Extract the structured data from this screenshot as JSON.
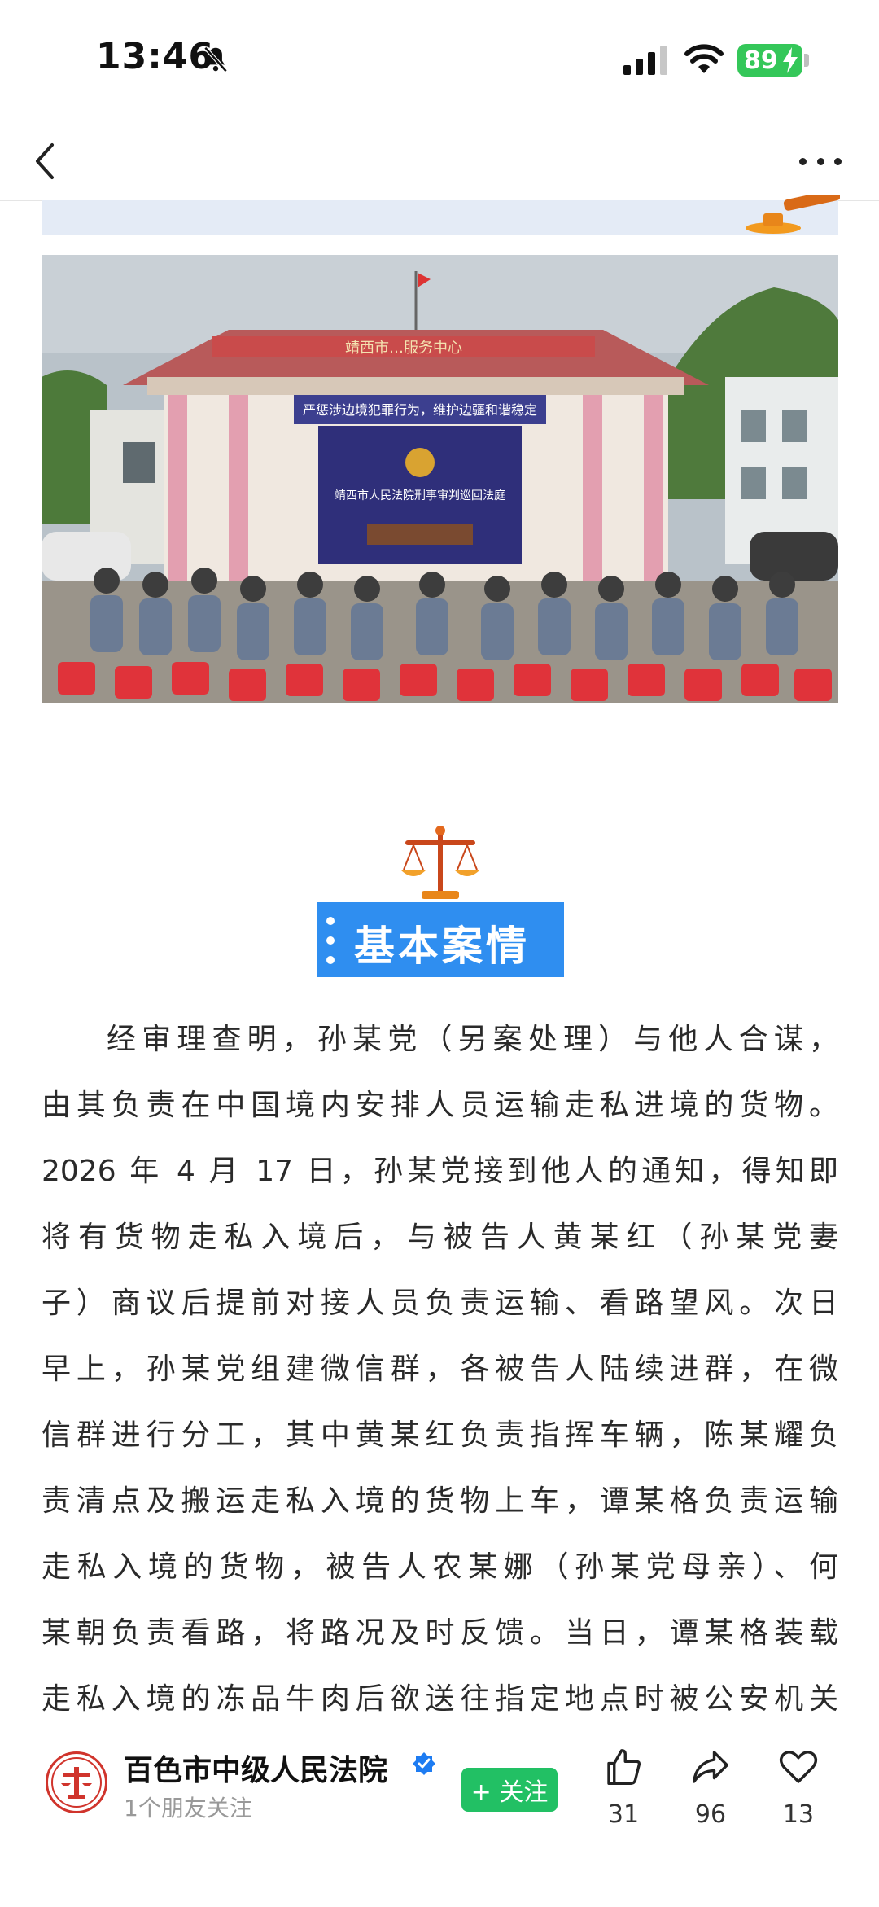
{
  "status_bar": {
    "time": "13:46",
    "battery": "89"
  },
  "nav": {
    "back_icon": "chevron-left-icon",
    "more_icon": "more-dots-icon"
  },
  "photo": {
    "sign_top": "靖西市…服务中心",
    "banner": "严惩涉边境犯罪行为，维护边疆和谐稳定",
    "court_banner": "靖西市人民法院刑事审判巡回法庭"
  },
  "section": {
    "title": "基本案情"
  },
  "article": {
    "lines": [
      "经审理查明，孙某党（另案处理）与他人合谋，",
      "由其负责在中国境内安排人员运输走私进境的货物。",
      "2026 年 4 月 17 日，孙某党接到他人的通知，得知即",
      "将有货物走私入境后，与被告人黄某红（孙某党妻",
      "子）商议后提前对接人员负责运输、看路望风。次日",
      "早上，孙某党组建微信群，各被告人陆续进群，在微",
      "信群进行分工，其中黄某红负责指挥车辆，陈某耀负",
      "责清点及搬运走私入境的货物上车，谭某格负责运输",
      "走私入境的货物，被告人农某娜（孙某党母亲）、何",
      "某朝负责看路，将路况及时反馈。当日，谭某格装载",
      "走私入境的冻品牛肉后欲送往指定地点时被公安机关"
    ]
  },
  "bottom_bar": {
    "author": "百色市中级人民法院",
    "friends_following": "1个朋友关注",
    "follow_label": "+ 关注",
    "likes": "31",
    "shares": "96",
    "favorites": "13"
  },
  "colors": {
    "accent": "#2f8ef0",
    "follow": "#22c064",
    "battery": "#34c759"
  }
}
